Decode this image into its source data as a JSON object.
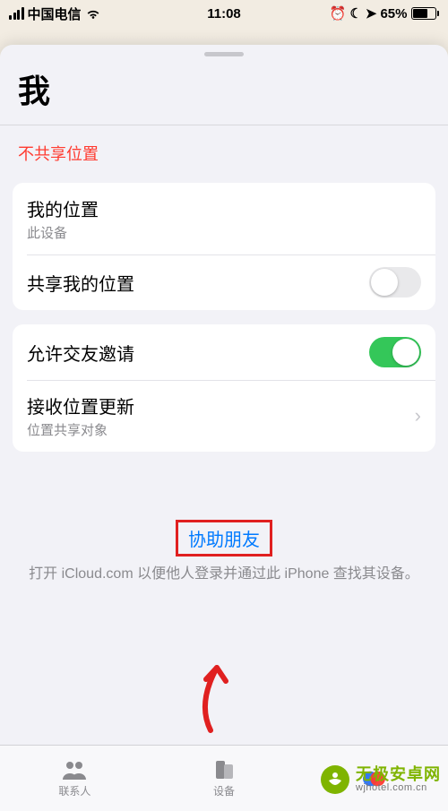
{
  "status_bar": {
    "carrier": "中国电信",
    "time": "11:08",
    "battery_pct": "65%",
    "icons": {
      "alarm": "⏰",
      "dnd": "☾",
      "location": "➤"
    }
  },
  "sheet": {
    "title": "我",
    "not_sharing": "不共享位置",
    "groups": [
      {
        "rows": [
          {
            "title": "我的位置",
            "sub": "此设备",
            "type": "text"
          },
          {
            "title": "共享我的位置",
            "type": "toggle",
            "on": false
          }
        ]
      },
      {
        "rows": [
          {
            "title": "允许交友邀请",
            "type": "toggle",
            "on": true
          },
          {
            "title": "接收位置更新",
            "sub": "位置共享对象",
            "type": "disclosure"
          }
        ]
      }
    ],
    "help": {
      "link": "协助朋友",
      "desc": "打开 iCloud.com 以便他人登录并通过此 iPhone 查找其设备。"
    }
  },
  "tabbar": {
    "items": [
      {
        "label": "联系人"
      },
      {
        "label": "设备"
      }
    ]
  },
  "watermark": {
    "main": "无极安卓网",
    "sub": "wjhotel.com.cn"
  }
}
